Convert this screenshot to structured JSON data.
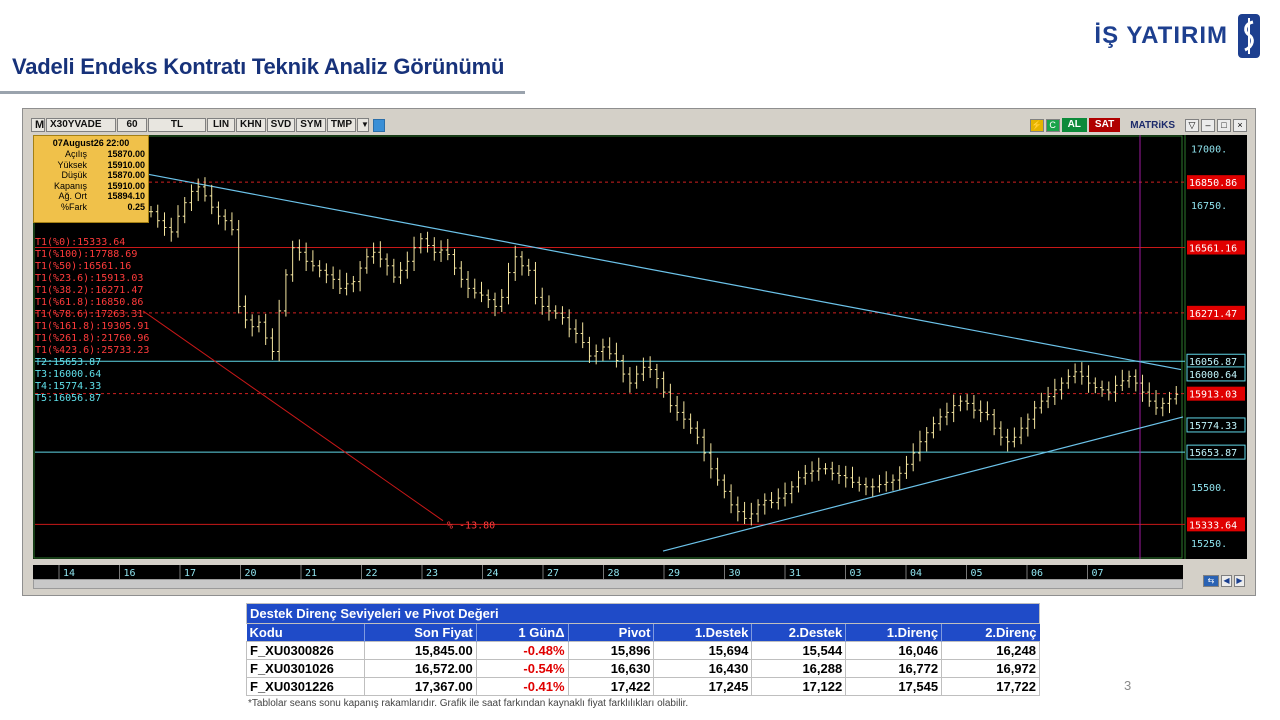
{
  "header": {
    "title": "Vadeli Endeks Kontratı Teknik Analiz Görünümü",
    "brand": "İŞ YATIRIM"
  },
  "toolbar": {
    "menu": "M",
    "symbol": "X30YVADE",
    "period": "60",
    "currency": "TL",
    "scale": "LIN",
    "buttons": [
      "KHN",
      "SVD",
      "SYM",
      "TMP"
    ],
    "buy_label": "AL",
    "sell_label": "SAT",
    "platform": "MATRiKS"
  },
  "tooltip": {
    "date": "07August26 22:00",
    "rows": [
      {
        "k": "Açılış",
        "v": "15870.00"
      },
      {
        "k": "Yüksek",
        "v": "15910.00"
      },
      {
        "k": "Düşük",
        "v": "15870.00"
      },
      {
        "k": "Kapanış",
        "v": "15910.00"
      },
      {
        "k": "Ağ. Ort",
        "v": "15894.10"
      },
      {
        "k": "%Fark",
        "v": "0.25"
      }
    ]
  },
  "chart_data": {
    "type": "candlestick",
    "ylim": [
      15180,
      17060
    ],
    "yticks": [
      {
        "v": 17000,
        "label": "17000."
      },
      {
        "v": 16750,
        "label": "16750."
      },
      {
        "v": 15500,
        "label": "15500."
      },
      {
        "v": 15250,
        "label": "15250."
      }
    ],
    "xticks": [
      "14",
      "16",
      "17",
      "20",
      "21",
      "22",
      "23",
      "24",
      "27",
      "28",
      "29",
      "30",
      "31",
      "03",
      "04",
      "05",
      "06",
      "07"
    ],
    "level_labels": [
      {
        "v": 16850.86,
        "label": "16850.86",
        "style": "red",
        "line": "dashed-red"
      },
      {
        "v": 16561.16,
        "label": "16561.16",
        "style": "red",
        "line": "solid-red"
      },
      {
        "v": 16271.47,
        "label": "16271.47",
        "style": "red",
        "line": "dashed-red"
      },
      {
        "v": 16056.87,
        "label": "16056.87",
        "style": "dark",
        "line": "solid-cyan"
      },
      {
        "v": 16000.64,
        "label": "16000.64",
        "style": "dark",
        "line": "none"
      },
      {
        "v": 15913.03,
        "label": "15913.03",
        "style": "red",
        "line": "dashed-red"
      },
      {
        "v": 15774.33,
        "label": "15774.33",
        "style": "dark",
        "line": "none"
      },
      {
        "v": 15653.87,
        "label": "15653.87",
        "style": "dark",
        "line": "solid-cyan"
      },
      {
        "v": 15333.64,
        "label": "15333.64",
        "style": "red",
        "line": "solid-red"
      }
    ],
    "fib_labels": [
      "T1(%0):15333.64",
      "T1(%100):17788.69",
      "T1(%50):16561.16",
      "T1(%23.6):15913.03",
      "T1(%38.2):16271.47",
      "T1(%61.8):16850.86",
      "T1(%78.6):17263.31",
      "T1(%161.8):19305.91",
      "T1(%261.8):21760.96",
      "T1(%423.6):25733.23"
    ],
    "t_labels": [
      "T2:15653.87",
      "T3:16000.64",
      "T4:15774.33",
      "T5:16056.87"
    ],
    "annotation": "% -13.80",
    "closes": [
      16720,
      16680,
      16650,
      16630,
      16700,
      16760,
      16810,
      16830,
      16790,
      16740,
      16700,
      16680,
      16640,
      16300,
      16240,
      16210,
      16230,
      16160,
      16100,
      16280,
      16440,
      16560,
      16540,
      16500,
      16480,
      16460,
      16440,
      16420,
      16380,
      16400,
      16410,
      16470,
      16520,
      16540,
      16510,
      16480,
      16430,
      16460,
      16500,
      16560,
      16600,
      16570,
      16540,
      16550,
      16530,
      16470,
      16420,
      16380,
      16360,
      16350,
      16330,
      16300,
      16340,
      16450,
      16520,
      16480,
      16460,
      16340,
      16300,
      16280,
      16270,
      16250,
      16200,
      16180,
      16140,
      16080,
      16100,
      16120,
      16090,
      16060,
      16000,
      15960,
      16000,
      16030,
      16020,
      15980,
      15920,
      15860,
      15830,
      15800,
      15760,
      15720,
      15650,
      15580,
      15530,
      15480,
      15420,
      15390,
      15360,
      15380,
      15420,
      15440,
      15430,
      15450,
      15470,
      15500,
      15540,
      15560,
      15570,
      15580,
      15580,
      15560,
      15550,
      15540,
      15520,
      15510,
      15500,
      15500,
      15510,
      15520,
      15530,
      15560,
      15600,
      15650,
      15700,
      15740,
      15780,
      15810,
      15830,
      15860,
      15880,
      15870,
      15840,
      15830,
      15820,
      15760,
      15720,
      15700,
      15720,
      15760,
      15800,
      15850,
      15880,
      15900,
      15930,
      15960,
      15990,
      16010,
      15990,
      15960,
      15940,
      15930,
      15920,
      15950,
      15970,
      15990,
      15960,
      15920,
      15880,
      15850,
      15870,
      15890,
      15910
    ]
  },
  "table": {
    "caption": "Destek Direnç Seviyeleri ve Pivot Değeri",
    "headers": [
      "Kodu",
      "Son Fiyat",
      "1 GünΔ",
      "Pivot",
      "1.Destek",
      "2.Destek",
      "1.Direnç",
      "2.Direnç"
    ],
    "rows": [
      {
        "kodu": "F_XU0300826",
        "son": "15,845.00",
        "gun": "-0.48%",
        "pivot": "15,896",
        "d1": "15,694",
        "d2": "15,544",
        "r1": "16,046",
        "r2": "16,248"
      },
      {
        "kodu": "F_XU0301026",
        "son": "16,572.00",
        "gun": "-0.54%",
        "pivot": "16,630",
        "d1": "16,430",
        "d2": "16,288",
        "r1": "16,772",
        "r2": "16,972"
      },
      {
        "kodu": "F_XU0301226",
        "son": "17,367.00",
        "gun": "-0.41%",
        "pivot": "17,422",
        "d1": "17,245",
        "d2": "17,122",
        "r1": "17,545",
        "r2": "17,722"
      }
    ]
  },
  "footnote": "*Tablolar seans sonu kapanış rakamlarıdır. Grafik ile saat farkından kaynaklı fiyat farklılıkları olabilir.",
  "page_number": "3",
  "colors": {
    "title": "#17327a",
    "table_header": "#1f4bc8",
    "negative": "#e00000",
    "candle": "#f5e6a0",
    "trend": "#4fb3e6"
  }
}
